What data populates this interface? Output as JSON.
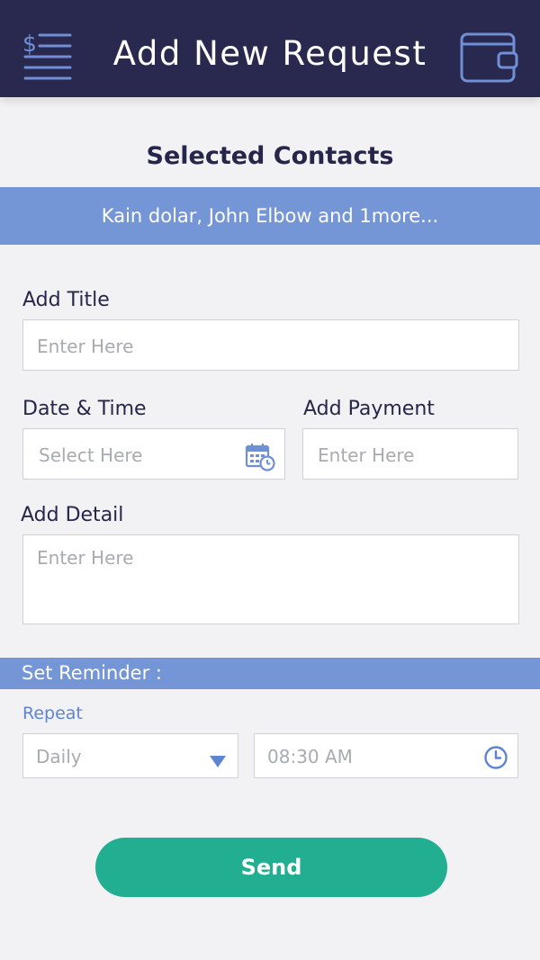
{
  "header": {
    "title": "Add New Request",
    "menu_icon": "dollar-list-icon",
    "wallet_icon": "wallet-icon"
  },
  "contacts": {
    "heading": "Selected Contacts",
    "summary": "Kain dolar, John Elbow and 1more..."
  },
  "form": {
    "title_label": "Add Title",
    "title_placeholder": "Enter Here",
    "datetime_label": "Date & Time",
    "datetime_placeholder": "Select Here",
    "payment_label": "Add Payment",
    "payment_placeholder": "Enter Here",
    "detail_label": "Add Detail",
    "detail_placeholder": "Enter Here"
  },
  "reminder": {
    "heading": "Set Reminder :",
    "repeat_label": "Repeat",
    "repeat_value": "Daily",
    "time_value": "08:30 AM"
  },
  "actions": {
    "send_label": "Send"
  },
  "colors": {
    "header_bg": "#29294f",
    "accent_blue": "#7496d6",
    "send_green": "#22ae90"
  }
}
